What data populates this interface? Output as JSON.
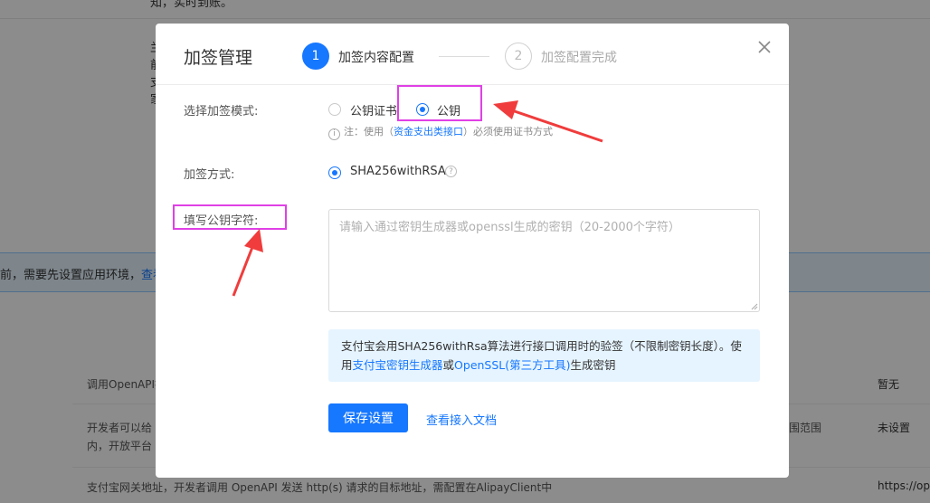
{
  "background": {
    "top_text": "知，实时到账。",
    "side_chars": [
      "兰",
      "前",
      "支",
      "家"
    ],
    "banner_text": "前，需要先设置应用环境，",
    "banner_link": "查看如",
    "rows": [
      {
        "label": "调用OpenAPI接",
        "value": "暂无"
      },
      {
        "label": "开发者可以给",
        "label2": "内，开放平台",
        "extra": "围范围",
        "value": "未设置"
      },
      {
        "label": "支付宝网关地址，开发者调用 OpenAPI 发送 http(s) 请求的目标地址，需配置在AlipayClient中",
        "value": "https://ope"
      }
    ]
  },
  "modal": {
    "title": "加签管理",
    "close_icon": "close-icon",
    "steps": [
      {
        "number": "1",
        "label": "加签内容配置",
        "state": "active"
      },
      {
        "number": "2",
        "label": "加签配置完成",
        "state": "pending"
      }
    ],
    "mode": {
      "label": "选择加签模式:",
      "options": [
        {
          "label": "公钥证书",
          "checked": false
        },
        {
          "label": "公钥",
          "checked": true
        }
      ],
      "note_prefix": "注：使用（",
      "note_link": "资金支出类接口",
      "note_suffix": "）必须使用证书方式"
    },
    "method": {
      "label": "加签方式:",
      "option": "SHA256withRSA",
      "help_icon": "?"
    },
    "key": {
      "label": "填写公钥字符:",
      "placeholder": "请输入通过密钥生成器或openssl生成的密钥（20-2000个字符）",
      "value": ""
    },
    "info": {
      "text1": "支付宝会用SHA256withRsa算法进行接口调用时的验签（不限制密钥长度）。使用",
      "link1": "支付宝密钥生成器",
      "text2": "或",
      "link2": "OpenSSL(第三方工具)",
      "text3": "生成密钥"
    },
    "save_button": "保存设置",
    "doc_link": "查看接入文档"
  },
  "colors": {
    "primary": "#1677ff",
    "highlight": "#e040e6",
    "arrow": "#f03c3c",
    "info_bg": "#e6f4ff"
  }
}
